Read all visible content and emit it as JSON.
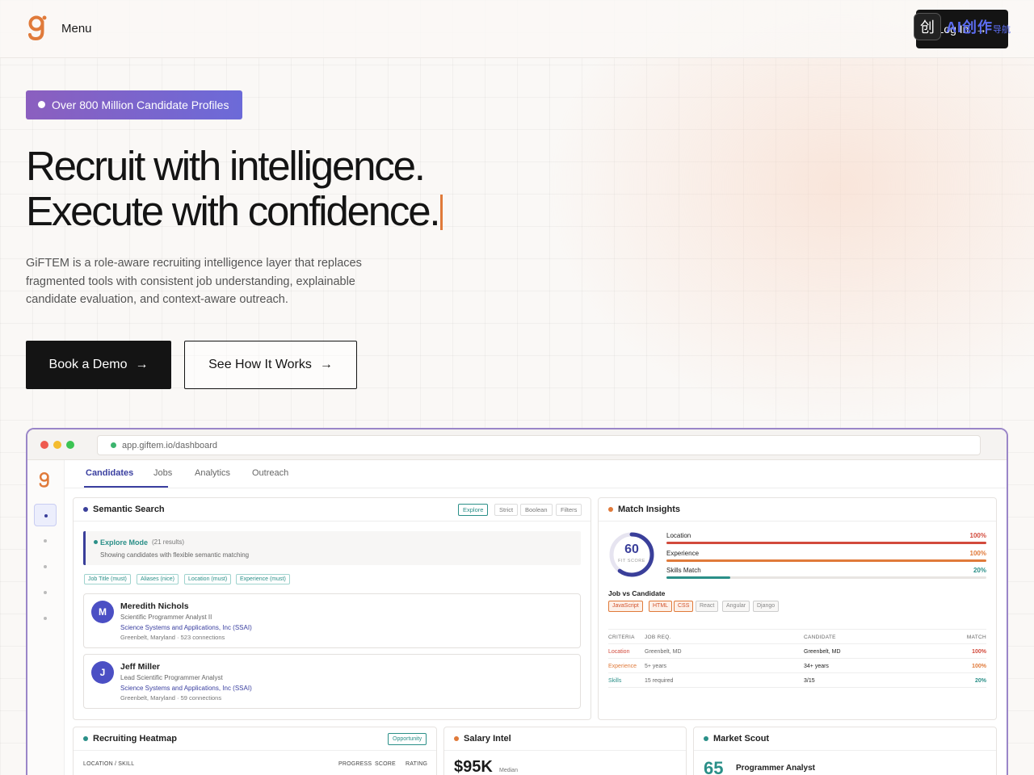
{
  "nav": {
    "menu_label": "Menu",
    "login_label": "Log In",
    "watermark_glyph": "创",
    "watermark_text": "AI创作",
    "watermark_sub": "导航"
  },
  "hero": {
    "badge": "Over 800 Million Candidate Profiles",
    "headline_line1": "Recruit with intelligence.",
    "headline_line2": "Execute with confidence.",
    "subtext": "GiFTEM is a role-aware recruiting intelligence layer that replaces fragmented tools with consistent job understanding, explainable candidate evaluation, and context-aware outreach.",
    "primary_cta": "Book a Demo",
    "secondary_cta": "See How It Works"
  },
  "app": {
    "url": "app.giftem.io/dashboard",
    "tabs": [
      "Candidates",
      "Jobs",
      "Analytics",
      "Outreach"
    ],
    "semantic_search": {
      "title": "Semantic Search",
      "modes": [
        "Explore",
        "Strict",
        "Boolean",
        "Filters"
      ],
      "explore_title": "Explore Mode",
      "explore_count": "(21 results)",
      "explore_sub": "Showing candidates with flexible semantic matching",
      "filters": [
        "Job Title (must)",
        "Aliases (nice)",
        "Location (must)",
        "Experience (must)"
      ],
      "candidates": [
        {
          "initial": "M",
          "name": "Meredith Nichols",
          "title": "Scientific Programmer Analyst II",
          "company": "Science Systems and Applications, Inc (SSAI)",
          "location": "Greenbelt, Maryland",
          "connections": "523 connections"
        },
        {
          "initial": "J",
          "name": "Jeff Miller",
          "title": "Lead Scientific Programmer Analyst",
          "company": "Science Systems and Applications, Inc (SSAI)",
          "location": "Greenbelt, Maryland",
          "connections": "59 connections"
        }
      ]
    },
    "match_insights": {
      "title": "Match Insights",
      "fit_score": "60",
      "fit_label": "FIT SCORE",
      "fit_fraction": 0.6,
      "bars": [
        {
          "label": "Location",
          "pct": "100%",
          "value": 1.0,
          "color": "#d24a3c"
        },
        {
          "label": "Experience",
          "pct": "100%",
          "value": 1.0,
          "color": "#e07a3a"
        },
        {
          "label": "Skills Match",
          "pct": "20%",
          "value": 0.2,
          "color": "#2a8f88"
        }
      ],
      "jvc_title": "Job vs Candidate",
      "skills": [
        {
          "name": "JavaScript",
          "hit": true
        },
        {
          "name": "HTML",
          "hit": true
        },
        {
          "name": "CSS",
          "hit": true
        },
        {
          "name": "React",
          "hit": false
        },
        {
          "name": "Angular",
          "hit": false
        },
        {
          "name": "Django",
          "hit": false
        }
      ],
      "table_head": [
        "CRITERIA",
        "JOB REQ.",
        "CANDIDATE",
        "MATCH"
      ],
      "table_rows": [
        {
          "criteria": "Location",
          "req": "Greenbelt, MD",
          "cand": "Greenbelt, MD",
          "match": "100%",
          "color": "#d24a3c"
        },
        {
          "criteria": "Experience",
          "req": "5+ years",
          "cand": "34+ years",
          "match": "100%",
          "color": "#e07a3a"
        },
        {
          "criteria": "Skills",
          "req": "15 required",
          "cand": "3/15",
          "match": "20%",
          "color": "#2a8f88"
        }
      ]
    },
    "heatmap": {
      "title": "Recruiting Heatmap",
      "badge": "Opportunity",
      "cols": [
        "LOCATION / SKILL",
        "PROGRESS",
        "SCORE",
        "RATING"
      ]
    },
    "salary": {
      "title": "Salary Intel",
      "value": "$95K",
      "label": "Median"
    },
    "scout": {
      "title": "Market Scout",
      "value": "65",
      "role": "Programmer Analyst"
    }
  },
  "colors": {
    "accent": "#3a3f9a",
    "teal": "#2a8f88",
    "orange": "#e07a3a",
    "red": "#d24a3c"
  }
}
